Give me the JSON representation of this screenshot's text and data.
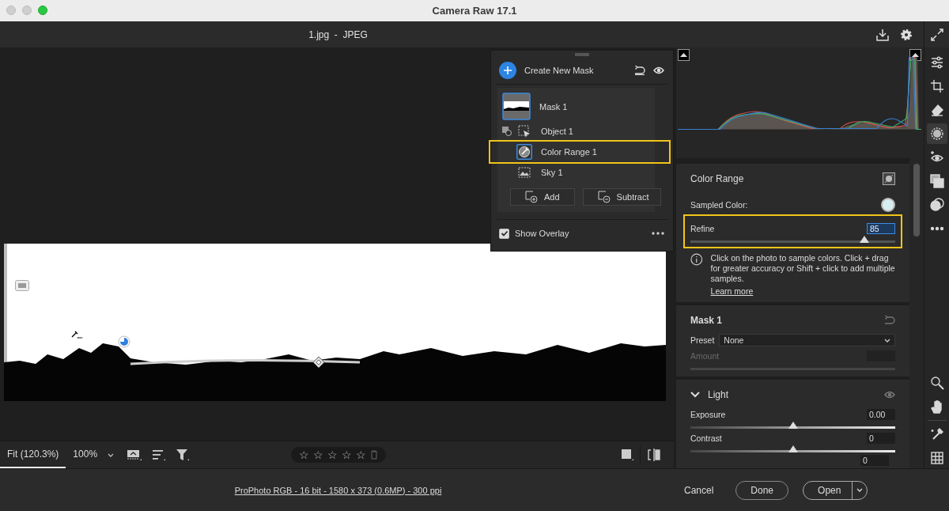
{
  "window": {
    "title": "Camera Raw 17.1"
  },
  "header": {
    "file": "1.jpg  -  JPEG"
  },
  "mask_panel": {
    "create_label": "Create New Mask",
    "masks": [
      {
        "name": "Mask 1",
        "selected": true,
        "components": [
          {
            "name": "Object 1",
            "kind": "object",
            "selected": false,
            "highlighted": false,
            "mode_icon": true
          },
          {
            "name": "Color Range 1",
            "kind": "color_range",
            "selected": true,
            "highlighted": true,
            "mode_icon": false
          },
          {
            "name": "Sky 1",
            "kind": "sky",
            "selected": false,
            "highlighted": false,
            "mode_icon": false
          }
        ]
      }
    ],
    "add": "Add",
    "subtract": "Subtract",
    "show_overlay": {
      "label": "Show Overlay",
      "checked": true
    }
  },
  "color_range": {
    "title": "Color Range",
    "sampled": {
      "label": "Sampled Color:",
      "color": "#d6eef0"
    },
    "refine": {
      "label": "Refine",
      "value": "85",
      "level": 0.85,
      "highlighted": true
    },
    "info": "Click on the photo to sample colors. Click + drag for greater accuracy or Shift + click to add multiple samples.",
    "learn_more": "Learn more"
  },
  "mask_settings": {
    "title": "Mask 1",
    "preset_label": "Preset",
    "preset_value": "None",
    "amount": {
      "label": "Amount",
      "disabled": true
    }
  },
  "light": {
    "title": "Light",
    "expanded": true,
    "sliders": [
      {
        "label": "Exposure",
        "value": "0.00",
        "level": 0.5
      },
      {
        "label": "Contrast",
        "value": "0",
        "level": 0.5
      }
    ],
    "next_value": "0"
  },
  "zoom_tabs": [
    {
      "label": "Fit (120.3%)",
      "selected": true
    },
    {
      "label": "100%",
      "selected": false
    }
  ],
  "rating": {
    "stars": 0
  },
  "tools": [
    {
      "kind": "edit",
      "selected": false
    },
    {
      "kind": "crop",
      "selected": false
    },
    {
      "kind": "eraser",
      "selected": false
    },
    {
      "kind": "masking",
      "selected": true
    },
    {
      "kind": "redeye",
      "selected": false
    },
    {
      "kind": "presets",
      "selected": false
    },
    {
      "kind": "snapshots",
      "selected": false
    },
    {
      "kind": "more",
      "selected": false
    }
  ],
  "view_tools": [
    {
      "kind": "zoom",
      "selected": false
    },
    {
      "kind": "hand",
      "selected": false
    },
    {
      "kind": "sampler",
      "selected": false
    },
    {
      "kind": "grid",
      "selected": false
    }
  ],
  "footer": {
    "info": "ProPhoto RGB - 16 bit - 1580 x 373 (0.6MP) - 300 ppi",
    "cancel": "Cancel",
    "done": "Done",
    "open": "Open"
  }
}
